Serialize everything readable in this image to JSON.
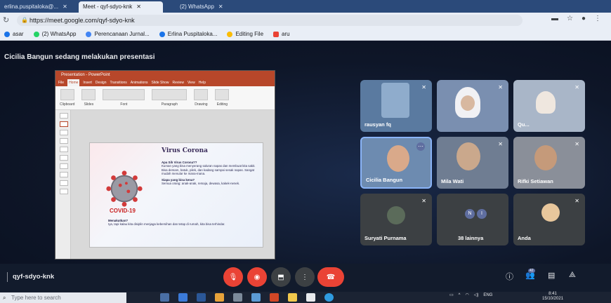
{
  "browser": {
    "tabs": [
      {
        "label": "erlina.puspitaloka@...",
        "active": false
      },
      {
        "label": "Meet - qyf-sdyo-knk",
        "active": true
      },
      {
        "label": "(2) WhatsApp",
        "active": false
      }
    ],
    "url": "https://meet.google.com/qyf-sdyo-knk",
    "bookmarks": [
      {
        "label": "asar",
        "color": "#1a73e8"
      },
      {
        "label": "(2) WhatsApp",
        "color": "#25d366"
      },
      {
        "label": "Perencanaan Jurnal...",
        "color": "#4285f4"
      },
      {
        "label": "Erlina Puspitaloka...",
        "color": "#1a73e8"
      },
      {
        "label": "Editing File",
        "color": "#fbbc04"
      },
      {
        "label": "aru",
        "color": "#ea4335"
      }
    ]
  },
  "meet": {
    "presenting_text": "Cicilia Bangun sedang melakukan presentasi",
    "meeting_code": "qyf-sdyo-knk",
    "participants": [
      {
        "name": "rausyan fq",
        "muted": true
      },
      {
        "name": "",
        "muted": true
      },
      {
        "name": "Qu...",
        "muted": true
      },
      {
        "name": "Cicilia Bangun",
        "muted": false,
        "active": true
      },
      {
        "name": "Mila Wati",
        "muted": true
      },
      {
        "name": "Rifki Setiawan",
        "muted": true
      },
      {
        "name": "Suryati Purnama",
        "muted": true
      },
      {
        "name": "38 lainnya",
        "muted": false
      },
      {
        "name": "Anda",
        "muted": true
      }
    ],
    "more_initials": [
      "N",
      "I"
    ],
    "people_badge": "42"
  },
  "slide": {
    "title": "Virus Corona",
    "covid_label": "COVID-19",
    "q1": "Apa Sih Virus Corona??",
    "a1": "Kuman yang bisa menyerang saluran napas dan membuat kita sakit.",
    "a1b": "Bisa demam, batuk, pilek, dan kadang sampai sesak napas. Sangat mudah menular ke mana-mana.",
    "q2": "Siapa yang bisa kena?",
    "a2": "Semua orang: anak-anak, remaja, dewasa, kakek-nenek.",
    "q3": "Menakutkan?",
    "a3": "Iya, tapi kalau kita disiplin menjaga kebersihan dan tetap di rumah, kita bisa terhindar."
  },
  "taskbar": {
    "search_placeholder": "Type here to search",
    "time": "8:41",
    "date": "15/10/2021",
    "lang": "ENG"
  }
}
